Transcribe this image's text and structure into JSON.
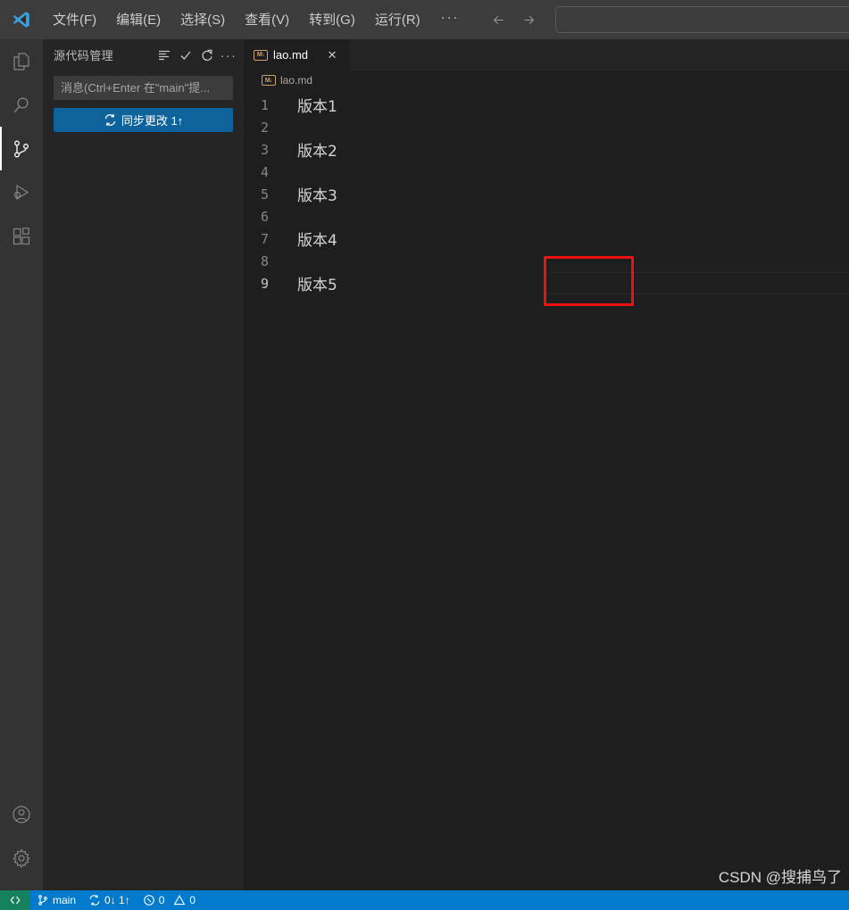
{
  "titlebar": {
    "logo_icon": "vscode-logo-icon",
    "menus": [
      {
        "label": "文件(F)",
        "name": "menu-file"
      },
      {
        "label": "编辑(E)",
        "name": "menu-edit"
      },
      {
        "label": "选择(S)",
        "name": "menu-selection"
      },
      {
        "label": "查看(V)",
        "name": "menu-view"
      },
      {
        "label": "转到(G)",
        "name": "menu-goto"
      },
      {
        "label": "运行(R)",
        "name": "menu-run"
      }
    ],
    "overflow_label": "···",
    "back_icon": "arrow-left-icon",
    "forward_icon": "arrow-right-icon",
    "search": {
      "value": "",
      "placeholder": ""
    }
  },
  "activitybar": {
    "items": [
      {
        "name": "activitybar-item-explorer",
        "icon": "files-icon",
        "active": false
      },
      {
        "name": "activitybar-item-search",
        "icon": "search-icon",
        "active": false
      },
      {
        "name": "activitybar-item-source-control",
        "icon": "source-control-icon",
        "active": true
      },
      {
        "name": "activitybar-item-run-debug",
        "icon": "run-and-debug-icon",
        "active": false
      },
      {
        "name": "activitybar-item-extensions",
        "icon": "extensions-icon",
        "active": false
      }
    ],
    "bottom": [
      {
        "name": "activitybar-item-accounts",
        "icon": "account-icon"
      },
      {
        "name": "activitybar-item-settings",
        "icon": "gear-icon"
      }
    ]
  },
  "sidebar": {
    "title": "源代码管理",
    "actions": [
      {
        "name": "view-as-list-button",
        "icon": "list-lines-icon"
      },
      {
        "name": "commit-button",
        "icon": "check-icon"
      },
      {
        "name": "refresh-button",
        "icon": "refresh-icon"
      },
      {
        "name": "more-actions-button",
        "icon": "ellipsis-icon",
        "label": "···"
      }
    ],
    "commit_input": {
      "value": "",
      "placeholder": "消息(Ctrl+Enter 在\"main\"提..."
    },
    "sync_button": {
      "label": "同步更改 1↑",
      "icon": "sync-icon",
      "background": "#0e639c"
    }
  },
  "editor": {
    "tabs": [
      {
        "name": "tab-lao-md",
        "label": "lao.md",
        "icon": "markdown-file-icon",
        "active": true,
        "close_icon": "close-icon"
      }
    ],
    "breadcrumb": {
      "label": "lao.md",
      "icon": "markdown-file-icon"
    },
    "file": "lao.md",
    "lines": [
      {
        "number": "1",
        "text": "版本1",
        "current": false
      },
      {
        "number": "2",
        "text": "",
        "current": false
      },
      {
        "number": "3",
        "text": "版本2",
        "current": false
      },
      {
        "number": "4",
        "text": "",
        "current": false
      },
      {
        "number": "5",
        "text": "版本3",
        "current": false
      },
      {
        "number": "6",
        "text": "",
        "current": false
      },
      {
        "number": "7",
        "text": "版本4",
        "current": false
      },
      {
        "number": "8",
        "text": "",
        "current": false
      },
      {
        "number": "9",
        "text": "版本5",
        "current": true
      }
    ],
    "annotation": {
      "name": "red-highlight-box",
      "color": "#ee1111"
    }
  },
  "statusbar": {
    "remote_icon": "remote-window-icon",
    "branch": {
      "icon": "git-branch-icon",
      "label": "main"
    },
    "sync": {
      "icon": "sync-icon",
      "label": "0↓ 1↑"
    },
    "problems": {
      "error_icon": "error-circle-icon",
      "errors": "0",
      "warning_icon": "warning-triangle-icon",
      "warnings": "0"
    },
    "background": "#007acc"
  },
  "watermark": {
    "text": "CSDN @搜捕鸟了"
  }
}
